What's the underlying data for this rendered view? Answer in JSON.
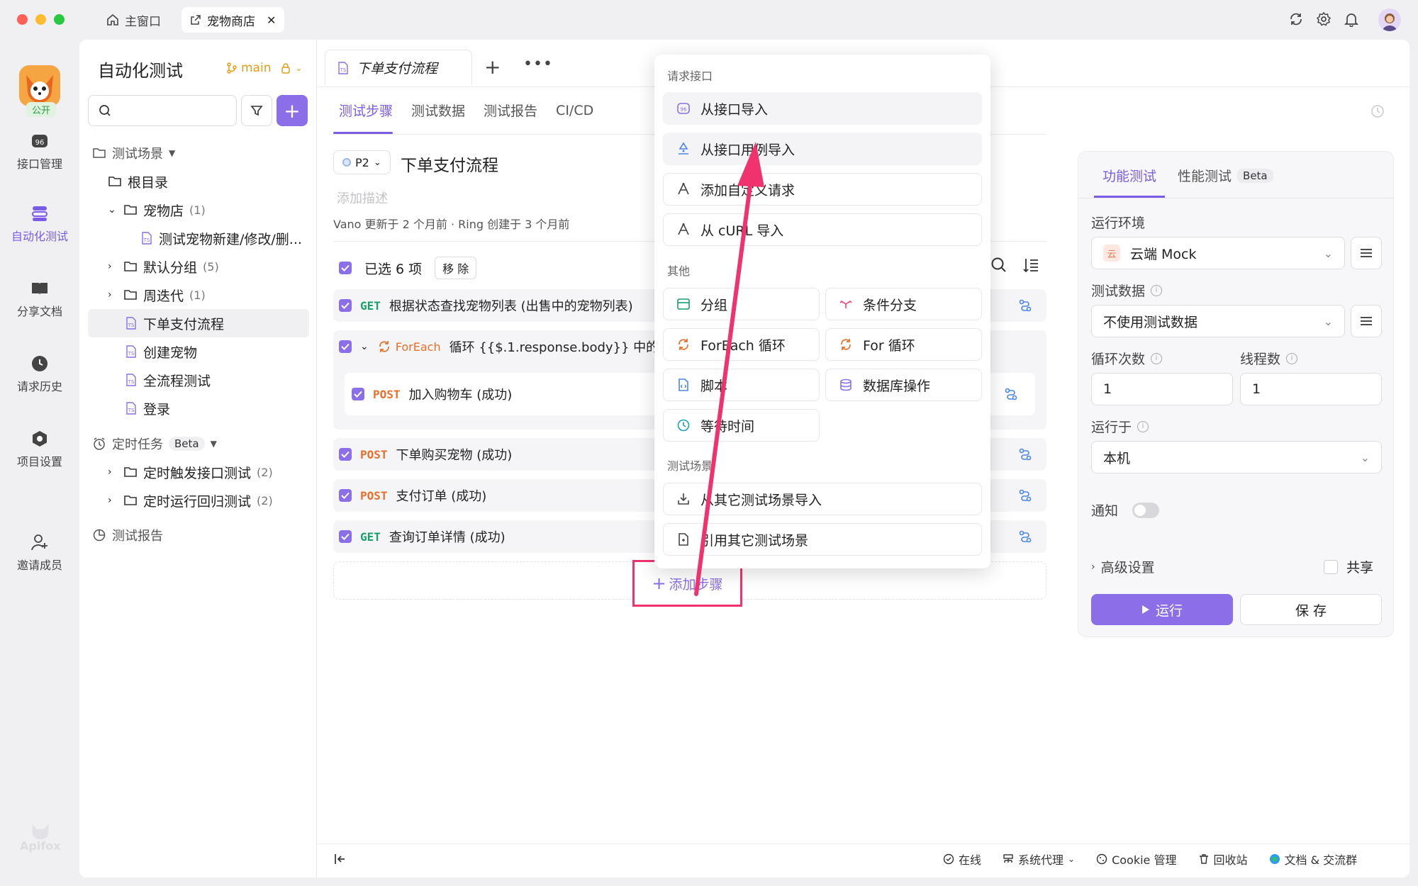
{
  "titlebar": {
    "tabs": [
      {
        "label": "主窗口"
      },
      {
        "label": "宠物商店"
      }
    ]
  },
  "nav": {
    "project_badge": "公开",
    "items": [
      {
        "label": "接口管理"
      },
      {
        "label": "自动化测试"
      },
      {
        "label": "分享文档"
      },
      {
        "label": "请求历史"
      },
      {
        "label": "项目设置"
      },
      {
        "label": "邀请成员"
      }
    ],
    "brand": "Apifox"
  },
  "sidebar": {
    "title": "自动化测试",
    "branch": "main",
    "search_placeholder": "",
    "tree": {
      "scenes_label": "测试场景",
      "root": "根目录",
      "petstore": {
        "label": "宠物店",
        "count": "(1)"
      },
      "petstore_child": "测试宠物新建/修改/删...",
      "default_group": {
        "label": "默认分组",
        "count": "(5)"
      },
      "iteration": {
        "label": "周迭代",
        "count": "(1)"
      },
      "items": [
        "下单支付流程",
        "创建宠物",
        "全流程测试",
        "登录"
      ],
      "scheduled": {
        "label": "定时任务",
        "badge": "Beta"
      },
      "sched_1": {
        "label": "定时触发接口测试",
        "count": "(2)"
      },
      "sched_2": {
        "label": "定时运行回归测试",
        "count": "(2)"
      },
      "reports": "测试报告"
    }
  },
  "main": {
    "doc_tab": "下单支付流程",
    "subtabs": [
      "测试步骤",
      "测试数据",
      "测试报告",
      "CI/CD"
    ],
    "priority": "P2",
    "title": "下单支付流程",
    "desc_placeholder": "添加描述",
    "meta": "Vano 更新于 2 个月前 · Ring 创建于 3 个月前",
    "selected": "已选 6 项",
    "remove": "移 除",
    "steps": [
      {
        "method": "GET",
        "name": "根据状态查找宠物列表 (出售中的宠物列表)"
      },
      {
        "method": "ForEach",
        "name": "循环 {{$.1.response.body}} 中的"
      },
      {
        "method": "POST",
        "name": "加入购物车 (成功)"
      },
      {
        "method": "POST",
        "name": "下单购买宠物 (成功)"
      },
      {
        "method": "POST",
        "name": "支付订单 (成功)"
      },
      {
        "method": "GET",
        "name": "查询订单详情 (成功)"
      }
    ],
    "add_step": "添加步骤"
  },
  "menu": {
    "section_request": "请求接口",
    "request_items": [
      "从接口导入",
      "从接口用例导入",
      "添加自定义请求",
      "从 cURL 导入"
    ],
    "section_other": "其他",
    "other_items": [
      "分组",
      "条件分支",
      "ForEach 循环",
      "For 循环",
      "脚本",
      "数据库操作",
      "等待时间"
    ],
    "section_scene": "测试场景",
    "scene_items": [
      "从其它测试场景导入",
      "引用其它测试场景"
    ]
  },
  "rpanel": {
    "tabs": [
      "功能测试",
      "性能测试"
    ],
    "perf_badge": "Beta",
    "env_label": "运行环境",
    "env_icon_text": "云",
    "env_value": "云端 Mock",
    "data_label": "测试数据",
    "data_value": "不使用测试数据",
    "loops_label": "循环次数",
    "loops_value": "1",
    "threads_label": "线程数",
    "threads_value": "1",
    "runon_label": "运行于",
    "runon_value": "本机",
    "notify_label": "通知",
    "advanced": "高级设置",
    "share": "共享",
    "run": "运行",
    "save": "保 存"
  },
  "statusbar": {
    "items": [
      "在线",
      "系统代理",
      "Cookie 管理",
      "回收站",
      "文档 & 交流群"
    ]
  },
  "colors": {
    "accent": "#8b6fe8",
    "highlight": "#f0336e",
    "get": "#19a06b",
    "post": "#e8702a"
  }
}
